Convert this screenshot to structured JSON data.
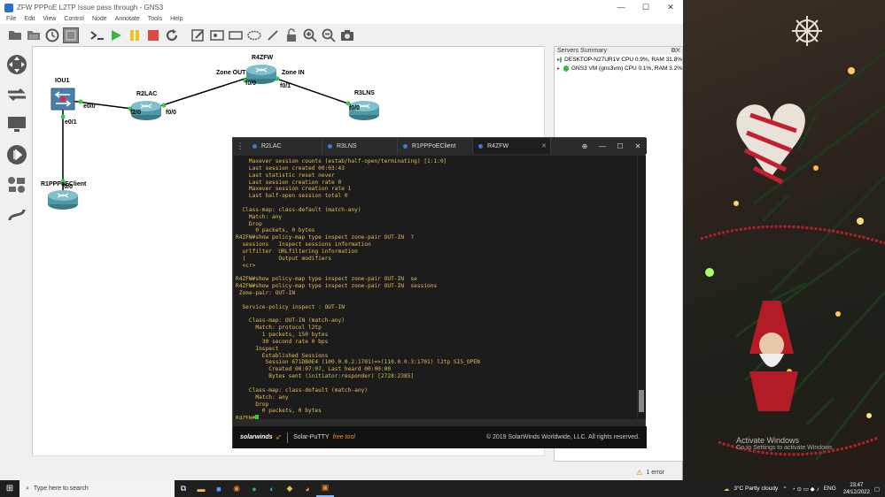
{
  "window": {
    "title": "ZFW PPPoE L2TP Issue pass through - GNS3",
    "controls": [
      "—",
      "☐",
      "✕"
    ]
  },
  "menubar": [
    "File",
    "Edit",
    "View",
    "Control",
    "Node",
    "Annotate",
    "Tools",
    "Help"
  ],
  "toolbar": [
    "open-folder",
    "project-folder",
    "clock",
    "capture",
    "console",
    "start",
    "pause",
    "stop",
    "reload",
    "note",
    "image",
    "rectangle",
    "ellipse",
    "line",
    "lock",
    "zoom-in",
    "zoom-out",
    "screenshot"
  ],
  "servers": {
    "title": "Servers Summary",
    "items": [
      {
        "name": "DESKTOP-N27UR1V",
        "stats": "CPU 0.9%, RAM 31.8%"
      },
      {
        "name": "GNS3 VM (gns3vm)",
        "stats": "CPU 0.1%, RAM 3.2%"
      }
    ]
  },
  "topology": {
    "nodes": {
      "iou1": "IOU1",
      "r2lac": "R2LAC",
      "r4zfw": "R4ZFW",
      "r3lns": "R3LNS",
      "r1client": "R1PPPoEClient"
    },
    "ports": {
      "iou1_e00": "e0/0",
      "iou1_e01": "e0/1",
      "r2lac_f20": "f2/0",
      "r2lac_f00": "f0/0",
      "r4zfw_f00": "f0/0",
      "r4zfw_f01": "f0/1",
      "r3lns_f00": "f0/0",
      "r1_f00": "f0/0"
    },
    "zones": {
      "out": "Zone OUT",
      "in": "Zone IN"
    }
  },
  "putty": {
    "tabs": [
      {
        "label": "R2LAC"
      },
      {
        "label": "R3LNS"
      },
      {
        "label": "R1PPPoEClient"
      },
      {
        "label": "R4ZFW"
      }
    ],
    "terminal": [
      "    Maxever session counts (estab/half-open/terminating) [1:1:0]",
      "    Last session created 00:03:43",
      "    Last statistic reset never",
      "    Last session creation rate 0",
      "    Maxever session creation rate 1",
      "    Last half-open session total 0",
      "",
      "  Class-map: class-default (match-any)",
      "    Match: any",
      "    Drop",
      "      0 packets, 0 bytes",
      "R4ZFW#show policy-map type inspect zone-pair OUT-IN  ?",
      "  sessions   Inspect sessions information",
      "  urlfilter  URLfiltering information",
      "  |          Output modifiers",
      "  <cr>",
      "",
      "R4ZFW#show policy-map type inspect zone-pair OUT-IN  se",
      "R4ZFW#show policy-map type inspect zone-pair OUT-IN  sessions",
      " Zone-pair: OUT-IN",
      "",
      "  Service-policy inspect : OUT-IN",
      "",
      "    Class-map: OUT-IN (match-any)",
      "      Match: protocol l2tp",
      "        1 packets, 150 bytes",
      "        30 second rate 0 bps",
      "      Inspect",
      "        Established Sessions",
      "         Session 671DB0E4 (100.0.0.2:1701)=>(110.0.0.3:1701) l2tp SIS_OPEN",
      "          Created 00:07:07, Last heard 00:00:00",
      "          Bytes sent (initiator:responder) [2728:2385]",
      "",
      "    Class-map: class-default (match-any)",
      "      Match: any",
      "      Drop",
      "        0 packets, 0 bytes",
      "R4ZFW#"
    ],
    "footer": {
      "brand": "solarwinds",
      "product": "Solar-PuTTY",
      "free": "free tool",
      "copyright": "© 2019 SolarWinds Worldwide, LLC. All rights reserved."
    }
  },
  "statusbar": {
    "errors": "1 error"
  },
  "watermark": {
    "title": "Activate Windows",
    "sub": "Go to Settings to activate Windows."
  },
  "taskbar": {
    "search_placeholder": "Type here to search",
    "weather": "3°C  Partly cloudy",
    "lang": "ENG",
    "time": "23:47",
    "date": "24/12/2022"
  },
  "colors": {
    "accent": "#f08a24",
    "terminal_text": "#e8bf55",
    "link_green": "#2ecc40"
  }
}
